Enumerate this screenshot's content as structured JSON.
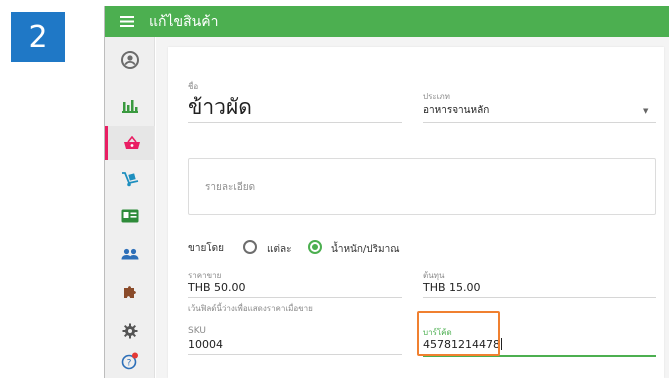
{
  "step_badge": "2",
  "appbar": {
    "title": "แก้ไขสินค้า",
    "menu_icon": "menu-icon"
  },
  "sidebar": {
    "items": [
      {
        "icon": "account-circle-icon",
        "active": false
      },
      {
        "icon": "bar-chart-icon",
        "active": false
      },
      {
        "icon": "basket-icon",
        "active": true
      },
      {
        "icon": "hand-truck-icon",
        "active": false
      },
      {
        "icon": "id-card-icon",
        "active": false
      },
      {
        "icon": "people-icon",
        "active": false
      },
      {
        "icon": "puzzle-icon",
        "active": false
      },
      {
        "icon": "gear-icon",
        "active": false
      },
      {
        "icon": "help-icon",
        "active": false
      }
    ]
  },
  "form": {
    "name": {
      "label": "ชื่อ",
      "value": "ข้าวผัด"
    },
    "category": {
      "label": "ประเภท",
      "value": "อาหารจานหลัก"
    },
    "description": {
      "placeholder": "รายละเอียด"
    },
    "sell_by": {
      "label": "ขายโดย",
      "option_each": "แต่ละ",
      "option_weight": "น้ำหนัก/ปริมาณ",
      "selected": "น้ำหนัก/ปริมาณ"
    },
    "price": {
      "label": "ราคาขาย",
      "value": "THB 50.00",
      "hint": "เว้นฟิลด์นี้ว่างเพื่อแสดงราคาเมื่อขาย"
    },
    "cost": {
      "label": "ต้นทุน",
      "value": "THB 15.00"
    },
    "sku": {
      "label": "SKU",
      "value": "10004"
    },
    "barcode": {
      "label": "บาร์โค้ด",
      "value": "45781214478"
    }
  },
  "colors": {
    "appbar": "#4caf50",
    "badge": "#1f78c6",
    "active_accent": "#e91e63",
    "highlight": "#f08030"
  }
}
